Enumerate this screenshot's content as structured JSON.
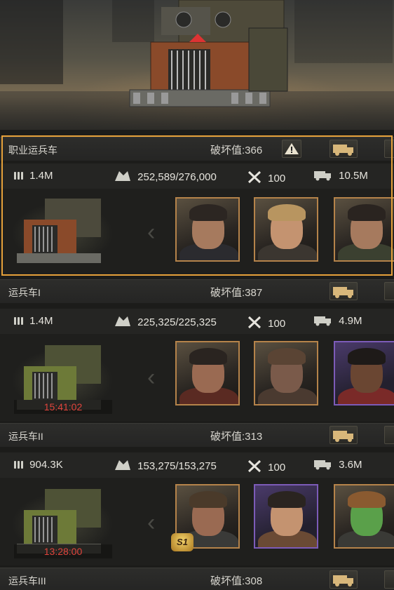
{
  "rows": [
    {
      "title": "职业运兵车",
      "power": "破坏值:366",
      "ammo": "1.4M",
      "health": "252,589/276,000",
      "repair": "100",
      "capacity": "10.5M",
      "timer": "",
      "selected": true
    },
    {
      "title": "运兵车I",
      "power": "破坏值:387",
      "ammo": "1.4M",
      "health": "225,325/225,325",
      "repair": "100",
      "capacity": "4.9M",
      "timer": "15:41:02",
      "selected": false
    },
    {
      "title": "运兵车II",
      "power": "破坏值:313",
      "ammo": "904.3K",
      "health": "153,275/153,275",
      "repair": "100",
      "capacity": "3.6M",
      "timer": "13:28:00",
      "selected": false
    },
    {
      "title": "运兵车III",
      "power": "破坏值:308"
    }
  ],
  "badge": "S1",
  "icons": {
    "ammo": "ammo-icon",
    "health": "health-icon",
    "repair": "wrench-icon",
    "capacity": "truck-load-icon",
    "warning": "warning-icon",
    "truck_button": "truck-icon"
  },
  "colors": {
    "selected_border": "#e6a13a",
    "timer": "#e0443c",
    "portrait_gold": "#b5834a",
    "portrait_purple": "#7c5bb8"
  }
}
